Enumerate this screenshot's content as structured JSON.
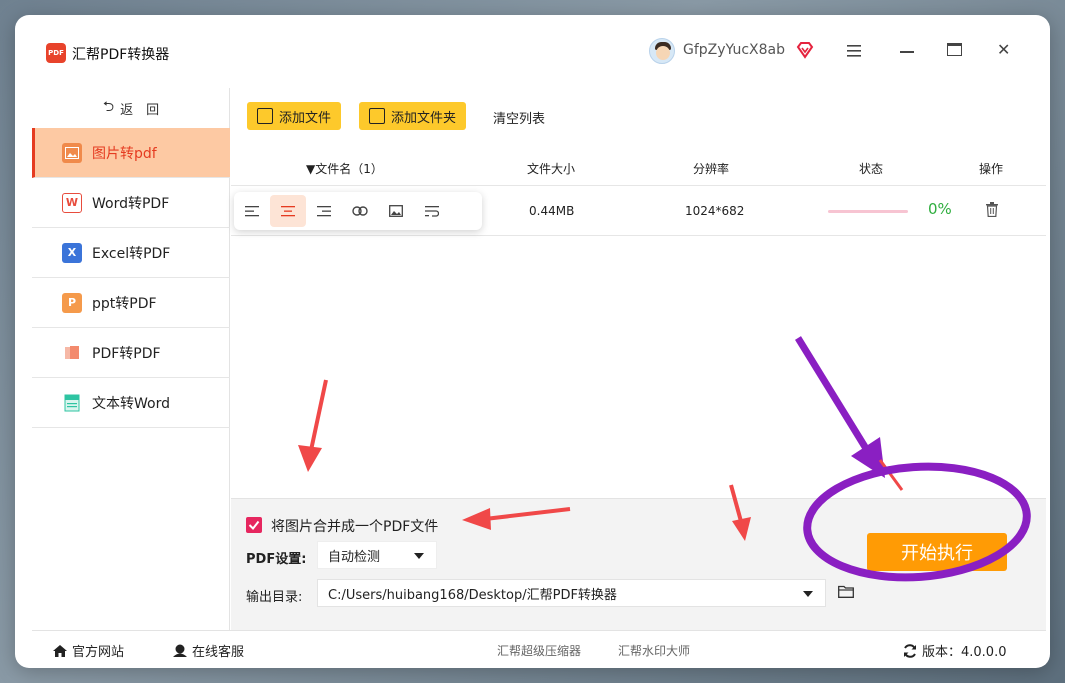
{
  "app": {
    "title": "汇帮PDF转换器",
    "logo_text": "PDF"
  },
  "user": {
    "name": "GfpZyYucX8ab"
  },
  "sidebar": {
    "back_label": "返　回",
    "items": [
      {
        "label": "图片转pdf",
        "icon_text": "",
        "color": "#f08a4b",
        "active": true
      },
      {
        "label": "Word转PDF",
        "icon_text": "W",
        "color": "#e84c3d"
      },
      {
        "label": "Excel转PDF",
        "icon_text": "X",
        "color": "#3b74d9"
      },
      {
        "label": "ppt转PDF",
        "icon_text": "P",
        "color": "#f59a4b"
      },
      {
        "label": "PDF转PDF",
        "icon_text": "",
        "color": "#f38a6d"
      },
      {
        "label": "文本转Word",
        "icon_text": "",
        "color": "#2ec4a2"
      }
    ]
  },
  "toolbar": {
    "add_file": "添加文件",
    "add_folder": "添加文件夹",
    "clear": "清空列表"
  },
  "table": {
    "headers": {
      "name": "文件名（1）",
      "size": "文件大小",
      "resolution": "分辨率",
      "status": "状态",
      "action": "操作"
    },
    "rows": [
      {
        "size": "0.44MB",
        "resolution": "1024*682",
        "progress": 0,
        "progress_text": "0%"
      }
    ]
  },
  "settings": {
    "merge_label": "将图片合并成一个PDF文件",
    "merge_checked": true,
    "pdf_label": "PDF设置:",
    "pdf_value": "自动检测",
    "output_label": "输出目录:",
    "output_value": "C:/Users/huibang168/Desktop/汇帮PDF转换器",
    "start_label": "开始执行"
  },
  "footer": {
    "website": "官方网站",
    "service": "在线客服",
    "link1": "汇帮超级压缩器",
    "link2": "汇帮水印大师",
    "version": "版本：4.0.0.0"
  },
  "colors": {
    "accent": "#e53b20",
    "button_yellow": "#fdc92b",
    "start_orange": "#ff9b05",
    "annot_red": "#f04848",
    "annot_purple": "#8a1fc2"
  }
}
